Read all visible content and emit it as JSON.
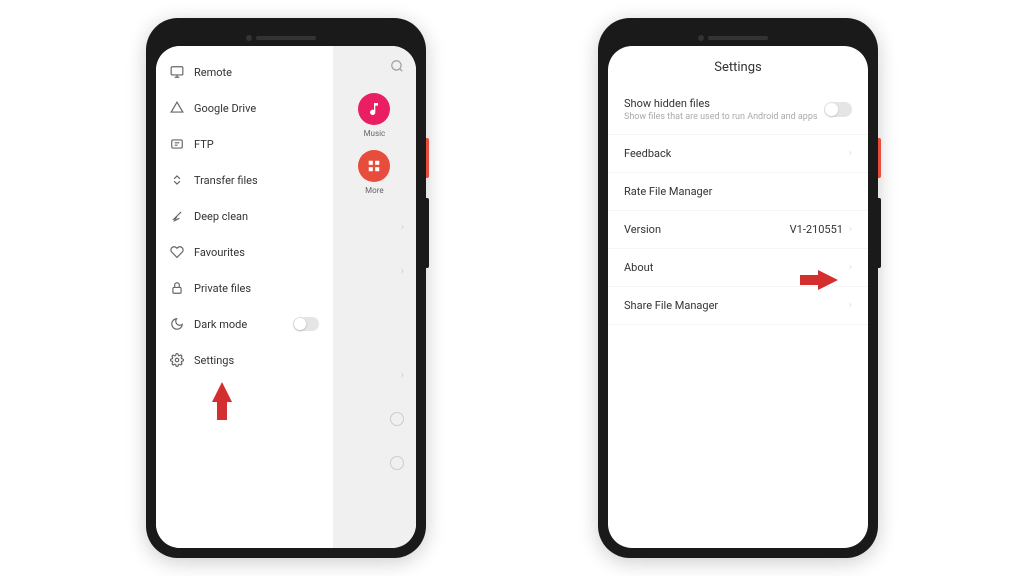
{
  "phone1": {
    "drawer": {
      "items": [
        {
          "icon": "monitor",
          "label": "Remote"
        },
        {
          "icon": "drive",
          "label": "Google Drive"
        },
        {
          "icon": "ftp",
          "label": "FTP"
        },
        {
          "icon": "transfer",
          "label": "Transfer files"
        },
        {
          "icon": "broom",
          "label": "Deep clean"
        },
        {
          "icon": "heart",
          "label": "Favourites"
        },
        {
          "icon": "lock",
          "label": "Private files"
        },
        {
          "icon": "moon",
          "label": "Dark mode",
          "toggle": true
        },
        {
          "icon": "gear",
          "label": "Settings"
        }
      ]
    },
    "home": {
      "apps": [
        {
          "name": "Music",
          "bg": "music-bg",
          "iconName": "music-note-icon"
        },
        {
          "name": "More",
          "bg": "more-bg",
          "iconName": "grid-icon"
        }
      ]
    }
  },
  "phone2": {
    "title": "Settings",
    "rows": [
      {
        "title": "Show hidden files",
        "sub": "Show files that are used to run Android and apps",
        "toggle": true
      },
      {
        "title": "Feedback",
        "chevron": true
      },
      {
        "title": "Rate File Manager"
      },
      {
        "title": "Version",
        "value": "V1-210551",
        "chevron": true
      },
      {
        "title": "About",
        "chevron": true
      },
      {
        "title": "Share File Manager",
        "chevron": true
      }
    ]
  }
}
